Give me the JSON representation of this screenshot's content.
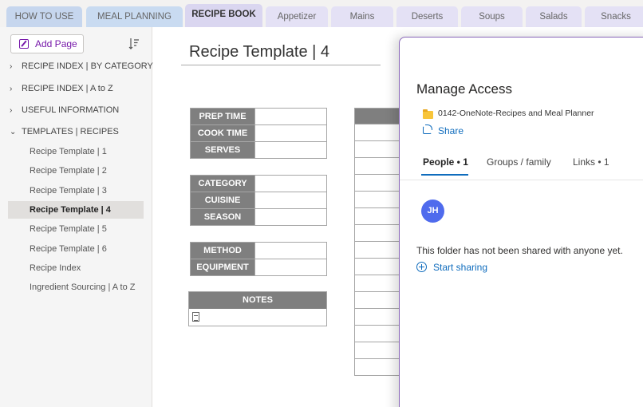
{
  "section_tabs": [
    {
      "label": "HOW TO USE",
      "color": "#c6d6ee",
      "active": false
    },
    {
      "label": "MEAL PLANNING",
      "color": "#c9dbf1",
      "active": false
    },
    {
      "label": "RECIPE BOOK",
      "color": "#dad6f0",
      "active": true
    },
    {
      "label": "Appetizer",
      "color": "#e4e1f5",
      "active": false
    },
    {
      "label": "Mains",
      "color": "#e4e1f5",
      "active": false
    },
    {
      "label": "Deserts",
      "color": "#e4e1f5",
      "active": false
    },
    {
      "label": "Soups",
      "color": "#e4e1f5",
      "active": false
    },
    {
      "label": "Salads",
      "color": "#e4e1f5",
      "active": false
    },
    {
      "label": "Snacks",
      "color": "#e4e1f5",
      "active": false
    }
  ],
  "sidebar": {
    "add_page_label": "Add Page",
    "sections": [
      {
        "label": "RECIPE INDEX | BY CATEGORY",
        "chevron": "›",
        "expanded": false
      },
      {
        "label": "RECIPE INDEX | A to Z",
        "chevron": "›",
        "expanded": false
      },
      {
        "label": "USEFUL INFORMATION",
        "chevron": "›",
        "expanded": false
      },
      {
        "label": "TEMPLATES | RECIPES",
        "chevron": "⌄",
        "expanded": true
      }
    ],
    "pages": [
      {
        "label": "Recipe Template | 1",
        "active": false
      },
      {
        "label": "Recipe Template | 2",
        "active": false
      },
      {
        "label": "Recipe Template | 3",
        "active": false
      },
      {
        "label": "Recipe Template | 4",
        "active": true
      },
      {
        "label": "Recipe Template | 5",
        "active": false
      },
      {
        "label": "Recipe Template | 6",
        "active": false
      },
      {
        "label": "Recipe Index",
        "active": false
      },
      {
        "label": "Ingredient Sourcing | A to Z",
        "active": false
      }
    ]
  },
  "page": {
    "title": "Recipe Template | 4",
    "block1": [
      "PREP TIME",
      "COOK TIME",
      "SERVES"
    ],
    "block2": [
      "CATEGORY",
      "CUISINE",
      "SEASON"
    ],
    "block3": [
      "METHOD",
      "EQUIPMENT"
    ],
    "notes_label": "NOTES"
  },
  "manage_access": {
    "title": "Manage Access",
    "folder_name": "0142-OneNote-Recipes and Meal Planner",
    "share_label": "Share",
    "tabs": [
      {
        "label": "People • 1",
        "active": true
      },
      {
        "label": "Groups / family",
        "active": false
      },
      {
        "label": "Links • 1",
        "active": false
      }
    ],
    "avatar_initials": "JH",
    "empty_message": "This folder has not been shared with anyone yet.",
    "start_sharing_label": "Start sharing",
    "accent_color": "#0f6cbd"
  }
}
